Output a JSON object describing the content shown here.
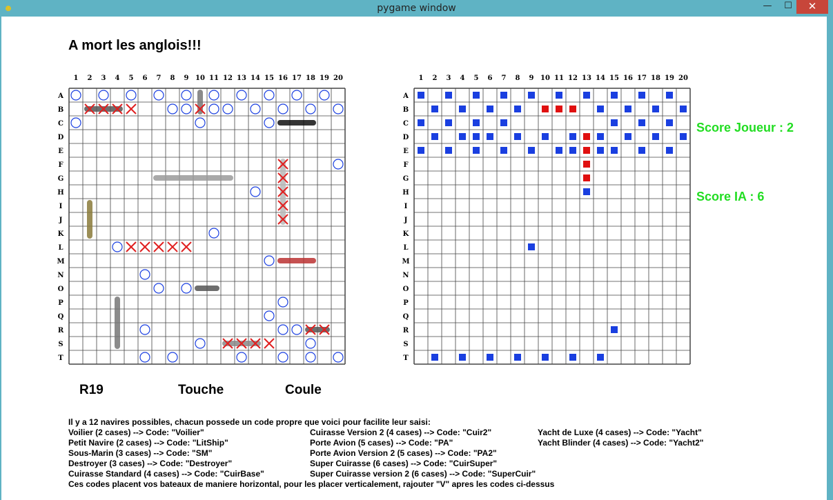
{
  "window": {
    "title": "pygame window",
    "minimize": "—",
    "maximize": "☐",
    "close": "✕",
    "icon": "pygame-snake-icon"
  },
  "heading": "A mort les anglois!!!",
  "columns": [
    "1",
    "2",
    "3",
    "4",
    "5",
    "6",
    "7",
    "8",
    "9",
    "10",
    "11",
    "12",
    "13",
    "14",
    "15",
    "16",
    "17",
    "18",
    "19",
    "20"
  ],
  "rows": [
    "A",
    "B",
    "C",
    "D",
    "E",
    "F",
    "G",
    "H",
    "I",
    "J",
    "K",
    "L",
    "M",
    "N",
    "O",
    "P",
    "Q",
    "R",
    "S",
    "T"
  ],
  "colors": {
    "miss_circle": "#1a3fe0",
    "hit_x": "#e02020",
    "player_shot": "#1a3fe0",
    "player_hit": "#e01010",
    "score": "#22dd22"
  },
  "player_board": {
    "misses": [
      "A1",
      "A3",
      "A5",
      "A7",
      "A9",
      "A11",
      "A13",
      "A15",
      "A17",
      "A19",
      "B8",
      "B9",
      "B11",
      "B12",
      "B14",
      "B16",
      "B18",
      "B20",
      "C1",
      "C10",
      "C15",
      "F20",
      "H14",
      "K11",
      "L4",
      "M15",
      "N6",
      "O7",
      "O9",
      "P16",
      "Q15",
      "R6",
      "R16",
      "R17",
      "S10",
      "S18",
      "T6",
      "T8",
      "T13",
      "T16",
      "T18",
      "T20"
    ],
    "hits": [
      "B2",
      "B3",
      "B4",
      "B5",
      "B10",
      "F16",
      "G16",
      "H16",
      "I16",
      "J16",
      "L5",
      "L6",
      "L7",
      "L8",
      "L9",
      "R18",
      "R19",
      "S12",
      "S13",
      "S14",
      "S15"
    ],
    "ships": [
      {
        "name": "ship-b-row",
        "row": "B",
        "col": 2,
        "len": 3,
        "dir": "h",
        "color": "#555"
      },
      {
        "name": "sub-c",
        "row": "C",
        "col": 16,
        "len": 3,
        "dir": "h",
        "color": "#111"
      },
      {
        "name": "cruiser-g",
        "row": "G",
        "col": 7,
        "len": 6,
        "dir": "h",
        "color": "#9a9a9a"
      },
      {
        "name": "carrier-f",
        "row": "F",
        "col": 16,
        "len": 5,
        "dir": "v",
        "color": "#b9b9b9"
      },
      {
        "name": "yacht-i",
        "row": "I",
        "col": 2,
        "len": 3,
        "dir": "v",
        "color": "#8a7a3a"
      },
      {
        "name": "destroyer-m",
        "row": "M",
        "col": 16,
        "len": 3,
        "dir": "h",
        "color": "#b33"
      },
      {
        "name": "boat-o",
        "row": "O",
        "col": 10,
        "len": 2,
        "dir": "h",
        "color": "#555"
      },
      {
        "name": "battleship-p",
        "row": "P",
        "col": 4,
        "len": 4,
        "dir": "v",
        "color": "#777"
      },
      {
        "name": "ship-r",
        "row": "R",
        "col": 18,
        "len": 2,
        "dir": "h",
        "color": "#555"
      },
      {
        "name": "ship-s",
        "row": "S",
        "col": 12,
        "len": 3,
        "dir": "h",
        "color": "#888"
      },
      {
        "name": "ship-b-vert",
        "row": "A",
        "col": 10,
        "len": 2,
        "dir": "v",
        "color": "#777"
      }
    ]
  },
  "enemy_board": {
    "misses": [
      "A1",
      "A3",
      "A5",
      "A7",
      "A9",
      "A11",
      "A13",
      "A15",
      "A17",
      "A19",
      "B2",
      "B4",
      "B6",
      "B8",
      "B14",
      "B16",
      "B18",
      "B20",
      "C1",
      "C3",
      "C5",
      "C7",
      "C15",
      "C17",
      "C19",
      "D2",
      "D4",
      "D5",
      "D6",
      "D8",
      "D10",
      "D12",
      "D14",
      "D16",
      "D18",
      "D20",
      "E1",
      "E3",
      "E5",
      "E7",
      "E9",
      "E11",
      "E12",
      "E14",
      "E15",
      "E17",
      "E19",
      "H13",
      "L9",
      "R15",
      "T2",
      "T4",
      "T6",
      "T8",
      "T10",
      "T12",
      "T14"
    ],
    "hits": [
      "B10",
      "B11",
      "B12",
      "D13",
      "E13",
      "F13",
      "G13"
    ]
  },
  "scores": {
    "player": "Score Joueur : 2",
    "ia": "Score IA : 6"
  },
  "status": {
    "last_shot": "R19",
    "result": "Touche",
    "sunk": "Coule"
  },
  "info": {
    "intro": "Il y a 12 navires possibles, chacun possede un code propre que voici pour facilite leur saisi:",
    "col1": [
      "Voilier (2 cases) --> Code: \"Voilier\"",
      "Petit Navire (2 cases) --> Code: \"LitShip\"",
      "Sous-Marin (3 cases) --> Code: \"SM\"",
      "Destroyer (3 cases) --> Code: \"Destroyer\"",
      "Cuirasse Standard (4 cases) --> Code: \"CuirBase\""
    ],
    "col2": [
      "Cuirasse Version 2 (4 cases) --> Code: \"Cuir2\"",
      "Porte Avion (5 cases) --> Code: \"PA\"",
      "Porte Avion Version 2 (5 cases) --> Code: \"PA2\"",
      "Super Cuirasse (6 cases) --> Code: \"CuirSuper\"",
      "Super Cuirasse version 2 (6 cases) --> Code: \"SuperCuir\""
    ],
    "col3": [
      "Yacht de Luxe (4 cases) --> Code: \"Yacht\"",
      "Yacht Blinder (4 cases) --> Code: \"Yacht2\""
    ],
    "outro": "Ces codes placent vos bateaux de maniere horizontal, pour les placer verticalement, rajouter \"V\" apres les codes ci-dessus"
  }
}
